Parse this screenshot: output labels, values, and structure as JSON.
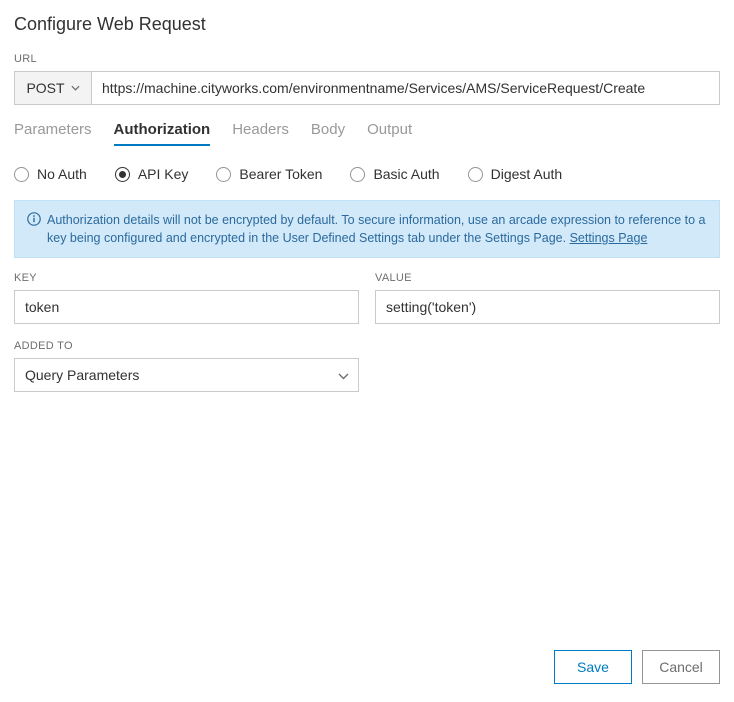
{
  "title": "Configure Web Request",
  "url_section": {
    "label": "URL",
    "method": "POST",
    "url": "https://machine.cityworks.com/environmentname/Services/AMS/ServiceRequest/Create"
  },
  "tabs": [
    {
      "label": "Parameters",
      "active": false
    },
    {
      "label": "Authorization",
      "active": true
    },
    {
      "label": "Headers",
      "active": false
    },
    {
      "label": "Body",
      "active": false
    },
    {
      "label": "Output",
      "active": false
    }
  ],
  "auth_options": [
    {
      "label": "No Auth",
      "selected": false
    },
    {
      "label": "API Key",
      "selected": true
    },
    {
      "label": "Bearer Token",
      "selected": false
    },
    {
      "label": "Basic Auth",
      "selected": false
    },
    {
      "label": "Digest Auth",
      "selected": false
    }
  ],
  "info_banner": {
    "text": "Authorization details will not be encrypted by default. To secure information, use an arcade expression to reference to a key being configured and encrypted in the User Defined Settings tab under the Settings Page. ",
    "link_text": "Settings Page"
  },
  "fields": {
    "key_label": "KEY",
    "key_value": "token",
    "value_label": "VALUE",
    "value_value": "setting('token')",
    "added_to_label": "ADDED TO",
    "added_to_value": "Query Parameters"
  },
  "footer": {
    "save": "Save",
    "cancel": "Cancel"
  }
}
